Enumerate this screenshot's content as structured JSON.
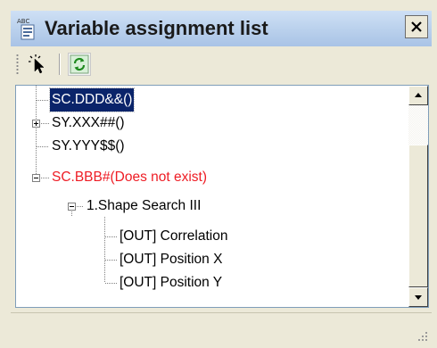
{
  "window": {
    "title": "Variable assignment list",
    "icons": {
      "app": "variable-list-icon",
      "close": "close-icon"
    }
  },
  "toolbar": {
    "items": [
      {
        "name": "select-tool",
        "icon": "cursor-sparkle-icon"
      },
      {
        "name": "refresh-tool",
        "icon": "refresh-icon"
      }
    ]
  },
  "tree": {
    "items": [
      {
        "label": "SC.DDD&&()",
        "level": 0,
        "expander": "none",
        "selected": true,
        "missing": false
      },
      {
        "label": "SY.XXX##()",
        "level": 0,
        "expander": "plus",
        "selected": false,
        "missing": false
      },
      {
        "label": "SY.YYY$$()",
        "level": 0,
        "expander": "none",
        "selected": false,
        "missing": false
      },
      {
        "label": "SC.BBB#(Does not exist)",
        "level": 0,
        "expander": "minus",
        "selected": false,
        "missing": true
      },
      {
        "label": "1.Shape Search III",
        "level": 1,
        "expander": "minus",
        "selected": false,
        "missing": false
      },
      {
        "label": "[OUT] Correlation",
        "level": 2,
        "expander": "none",
        "selected": false,
        "missing": false
      },
      {
        "label": "[OUT] Position X",
        "level": 2,
        "expander": "none",
        "selected": false,
        "missing": false
      },
      {
        "label": "[OUT] Position Y",
        "level": 2,
        "expander": "none",
        "selected": false,
        "missing": false
      }
    ]
  },
  "colors": {
    "selection_bg": "#0a246a",
    "missing_text": "#ee1c24",
    "title_bar": "#b9d0ec"
  }
}
